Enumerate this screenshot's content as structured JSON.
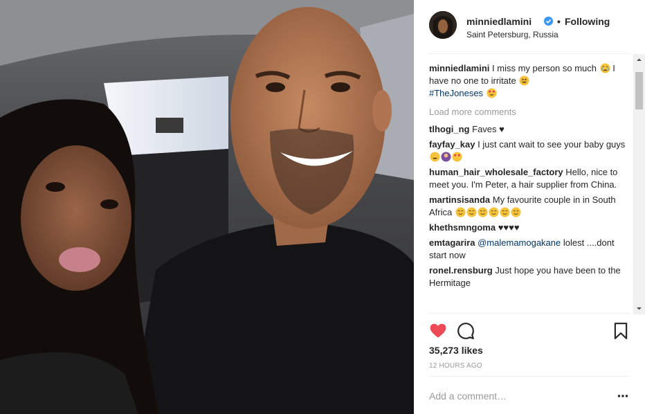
{
  "post": {
    "username": "minniedlamini",
    "follow_status": "Following",
    "location": "Saint Petersburg, Russia",
    "caption_user": "minniedlamini",
    "caption_text": "I miss my person so much",
    "caption_text2": "I have no one to irritate",
    "caption_hashtag": "#TheJoneses"
  },
  "load_more_label": "Load more comments",
  "comments": [
    {
      "user": "tlhogi_ng",
      "text": "Faves"
    },
    {
      "user": "fayfay_kay",
      "text": "I just cant wait to see your baby guys"
    },
    {
      "user": "human_hair_wholesale_factory",
      "text": "Hello, nice to meet you. I'm Peter, a hair supplier from China."
    },
    {
      "user": "martinsisanda",
      "text": "My favourite couple in in South Africa"
    },
    {
      "user": "khethsmngoma",
      "text": ""
    },
    {
      "user": "emtagarira",
      "mention": "@malemamogakane",
      "text": "lolest ....dont start now"
    },
    {
      "user": "ronel.rensburg",
      "text": "Just hope you have been to the Hermitage"
    }
  ],
  "likes": "35,273 likes",
  "timestamp": "12 HOURS AGO",
  "add_comment_placeholder": "Add a comment…",
  "icons": {
    "like": "heart-icon",
    "comment": "comment-icon",
    "save": "bookmark-icon",
    "options": "more-options-icon",
    "verified": "verified-badge-icon"
  },
  "colors": {
    "like_red": "#ed4956",
    "verified_blue": "#3897f0",
    "link_blue": "#003569",
    "muted": "#999999"
  }
}
